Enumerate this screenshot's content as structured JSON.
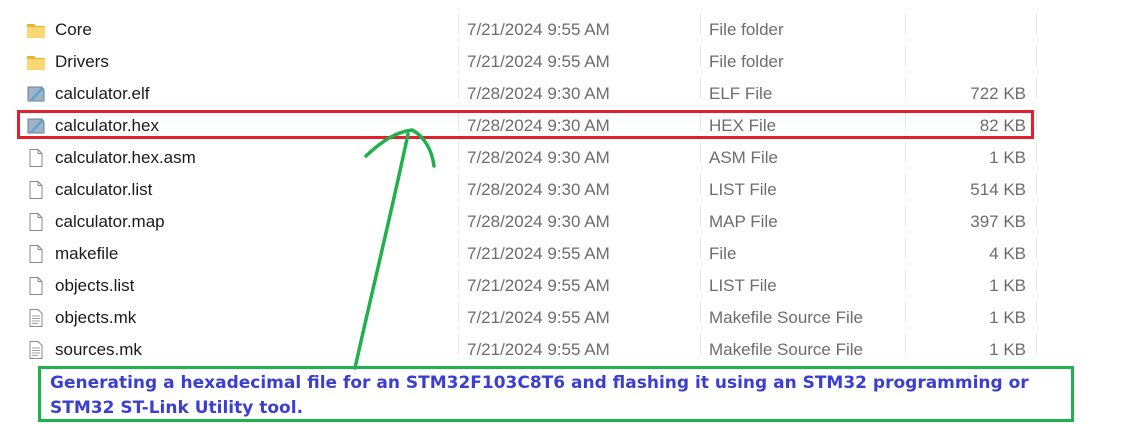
{
  "file_list": {
    "rows": [
      {
        "name": "Core",
        "date": "7/21/2024 9:55 AM",
        "type": "File folder",
        "size": "",
        "icon": "folder-icon"
      },
      {
        "name": "Drivers",
        "date": "7/21/2024 9:55 AM",
        "type": "File folder",
        "size": "",
        "icon": "folder-icon"
      },
      {
        "name": "calculator.elf",
        "date": "7/28/2024 9:30 AM",
        "type": "ELF File",
        "size": "722 KB",
        "icon": "binary-file-icon"
      },
      {
        "name": "calculator.hex",
        "date": "7/28/2024 9:30 AM",
        "type": "HEX File",
        "size": "82 KB",
        "icon": "binary-file-icon"
      },
      {
        "name": "calculator.hex.asm",
        "date": "7/28/2024 9:30 AM",
        "type": "ASM File",
        "size": "1 KB",
        "icon": "blank-file-icon"
      },
      {
        "name": "calculator.list",
        "date": "7/28/2024 9:30 AM",
        "type": "LIST File",
        "size": "514 KB",
        "icon": "blank-file-icon"
      },
      {
        "name": "calculator.map",
        "date": "7/28/2024 9:30 AM",
        "type": "MAP File",
        "size": "397 KB",
        "icon": "blank-file-icon"
      },
      {
        "name": "makefile",
        "date": "7/21/2024 9:55 AM",
        "type": "File",
        "size": "4 KB",
        "icon": "blank-file-icon"
      },
      {
        "name": "objects.list",
        "date": "7/21/2024 9:55 AM",
        "type": "LIST File",
        "size": "1 KB",
        "icon": "blank-file-icon"
      },
      {
        "name": "objects.mk",
        "date": "7/21/2024 9:55 AM",
        "type": "Makefile Source File",
        "size": "1 KB",
        "icon": "text-file-icon"
      },
      {
        "name": "sources.mk",
        "date": "7/21/2024 9:55 AM",
        "type": "Makefile Source File",
        "size": "1 KB",
        "icon": "text-file-icon"
      }
    ]
  },
  "annotation": {
    "caption": "Generating a hexadecimal file for an STM32F103C8T6 and flashing it using an STM32 programming or STM32 ST-Link Utility tool.",
    "highlight_color": "#e0202a",
    "arrow_color": "#21b04b",
    "caption_border_color": "#21b04b",
    "caption_text_color": "#3b3fd1"
  }
}
